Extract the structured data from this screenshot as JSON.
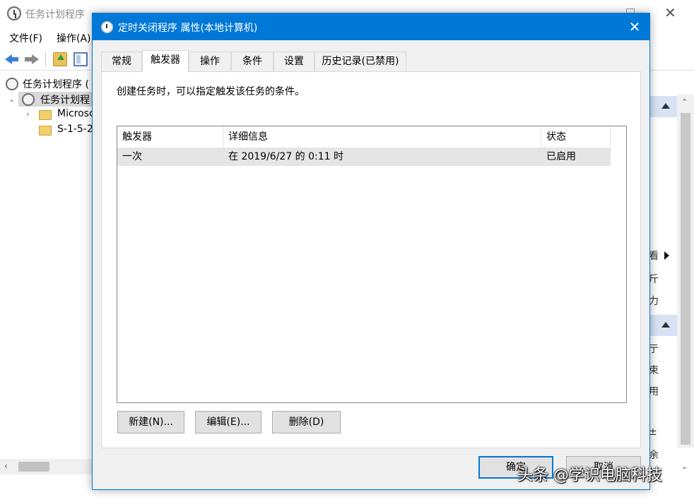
{
  "background_window": {
    "title": "任务计划程序",
    "menu": [
      "文件(F)",
      "操作(A)"
    ],
    "tree": {
      "root": "任务计划程序 (",
      "library": "任务计划程",
      "children": [
        "Microsc",
        "S-1-5-2"
      ]
    },
    "actions_fragments": [
      "看",
      "斤",
      "力",
      "亍",
      "束",
      "用",
      "±",
      "余"
    ]
  },
  "dialog": {
    "title": "定时关闭程序 属性(本地计算机)",
    "tabs": [
      "常规",
      "触发器",
      "操作",
      "条件",
      "设置",
      "历史记录(已禁用)"
    ],
    "active_tab": "触发器",
    "description": "创建任务时，可以指定触发该任务的条件。",
    "columns": [
      "触发器",
      "详细信息",
      "状态"
    ],
    "rows": [
      {
        "trigger": "一次",
        "detail": "在 2019/6/27 的 0:11 时",
        "status": "已启用"
      }
    ],
    "buttons": {
      "new": "新建(N)...",
      "edit": "编辑(E)...",
      "delete": "删除(D)",
      "ok": "确定",
      "cancel": "取消"
    }
  },
  "watermark": "头条 @学识电脑科技",
  "colors": {
    "accent": "#0078d7",
    "selected_row": "#e5e5e5",
    "dialog_bg": "#f0f0f0"
  }
}
